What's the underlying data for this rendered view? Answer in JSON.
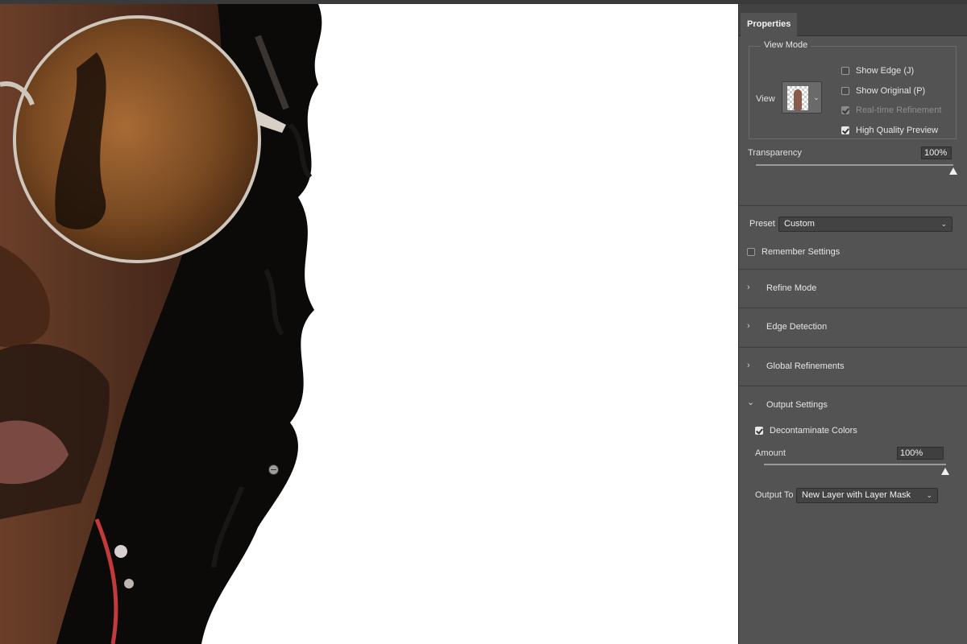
{
  "panel": {
    "tab_title": "Properties",
    "view_mode": {
      "legend": "View Mode",
      "view_label": "View",
      "checkboxes": [
        {
          "label": "Show Edge (J)",
          "checked": false,
          "disabled": false
        },
        {
          "label": "Show Original (P)",
          "checked": false,
          "disabled": false
        },
        {
          "label": "Real-time Refinement",
          "checked": true,
          "disabled": true
        },
        {
          "label": "High Quality Preview",
          "checked": true,
          "disabled": false
        }
      ]
    },
    "transparency": {
      "label": "Transparency",
      "value": "100%",
      "level": 1.0
    },
    "preset": {
      "label": "Preset",
      "value": "Custom"
    },
    "remember_settings": {
      "label": "Remember Settings",
      "checked": false
    },
    "sections": [
      {
        "label": "Refine Mode",
        "expanded": false
      },
      {
        "label": "Edge Detection",
        "expanded": false
      },
      {
        "label": "Global Refinements",
        "expanded": false
      },
      {
        "label": "Output Settings",
        "expanded": true
      }
    ],
    "output_settings": {
      "decontaminate": {
        "label": "Decontaminate Colors",
        "checked": true
      },
      "amount": {
        "label": "Amount",
        "value": "100%",
        "level": 1.0
      },
      "output_to": {
        "label": "Output To",
        "value": "New Layer with Layer Mask"
      }
    }
  },
  "icons": {
    "chevron_collapsed": "›",
    "chevron_expanded": "⌄",
    "dropdown_caret": "⌄"
  }
}
